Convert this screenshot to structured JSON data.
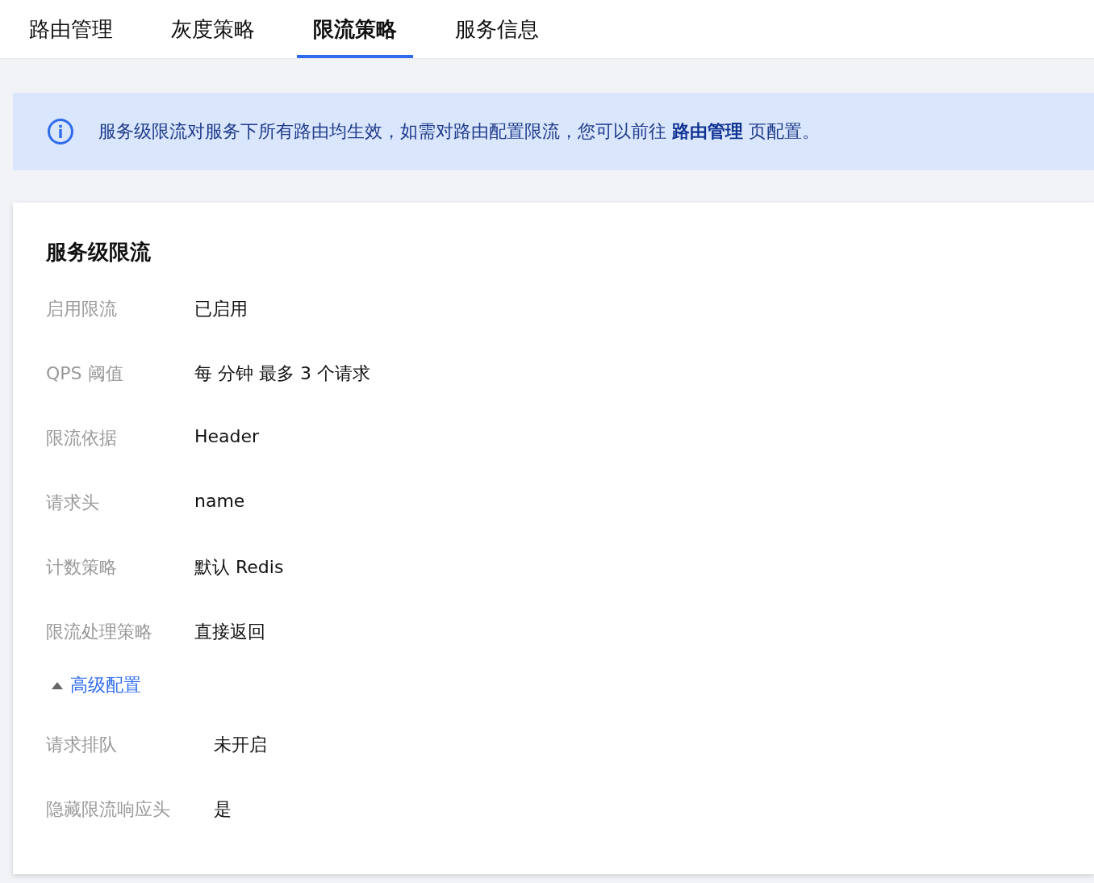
{
  "tabs": [
    {
      "label": "路由管理",
      "selected": false
    },
    {
      "label": "灰度策略",
      "selected": false
    },
    {
      "label": "限流策略",
      "selected": true
    },
    {
      "label": "服务信息",
      "selected": false
    }
  ],
  "notice": {
    "before": "服务级限流对服务下所有路由均生效，如需对路由配置限流，您可以前往 ",
    "link": "路由管理",
    "after": " 页配置。"
  },
  "card": {
    "title": "服务级限流",
    "fields": [
      {
        "label": "启用限流",
        "value": "已启用"
      },
      {
        "label": "QPS 阈值",
        "value": "每 分钟 最多 3 个请求"
      },
      {
        "label": "限流依据",
        "value": "Header"
      },
      {
        "label": "请求头",
        "value": "name"
      },
      {
        "label": "计数策略",
        "value": "默认 Redis"
      },
      {
        "label": "限流处理策略",
        "value": "直接返回"
      }
    ],
    "advanced": {
      "label": "高级配置",
      "expanded": true,
      "fields": [
        {
          "label": "请求排队",
          "value": "未开启"
        },
        {
          "label": "隐藏限流响应头",
          "value": "是"
        }
      ]
    }
  }
}
